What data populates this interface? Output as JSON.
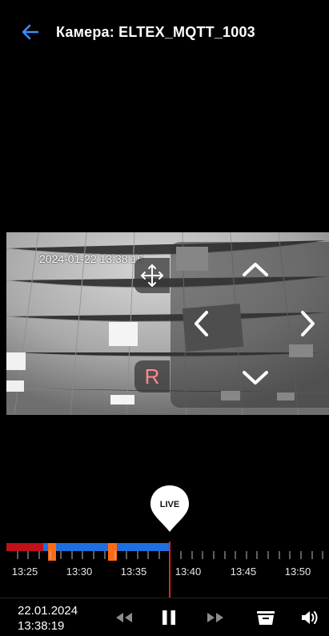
{
  "header": {
    "title": "Камера: ELTEX_MQTT_1003",
    "back_icon": "arrow-left-icon",
    "accent": "#3f8cff"
  },
  "video": {
    "osd_timestamp": "2024-01-22 13:38:16",
    "ptz": {
      "move_icon": "move-arrows-icon",
      "rec_label": "R",
      "up_icon": "chevron-up-icon",
      "down_icon": "chevron-down-icon",
      "left_icon": "chevron-left-icon",
      "right_icon": "chevron-right-icon"
    }
  },
  "live_marker": {
    "label": "LIVE"
  },
  "timeline": {
    "tick_labels": [
      "13:25",
      "13:30",
      "13:35",
      "13:40",
      "13:45",
      "13:50"
    ],
    "colors": {
      "archive": "#1e6fe0",
      "event": "#ff6a13",
      "gap": "#c0101a",
      "playhead": "#e0232b"
    }
  },
  "controls": {
    "date": "22.01.2024",
    "time": "13:38:19",
    "icons": [
      "rewind-icon",
      "pause-icon",
      "fast-forward-icon",
      "archive-icon",
      "volume-icon"
    ]
  }
}
